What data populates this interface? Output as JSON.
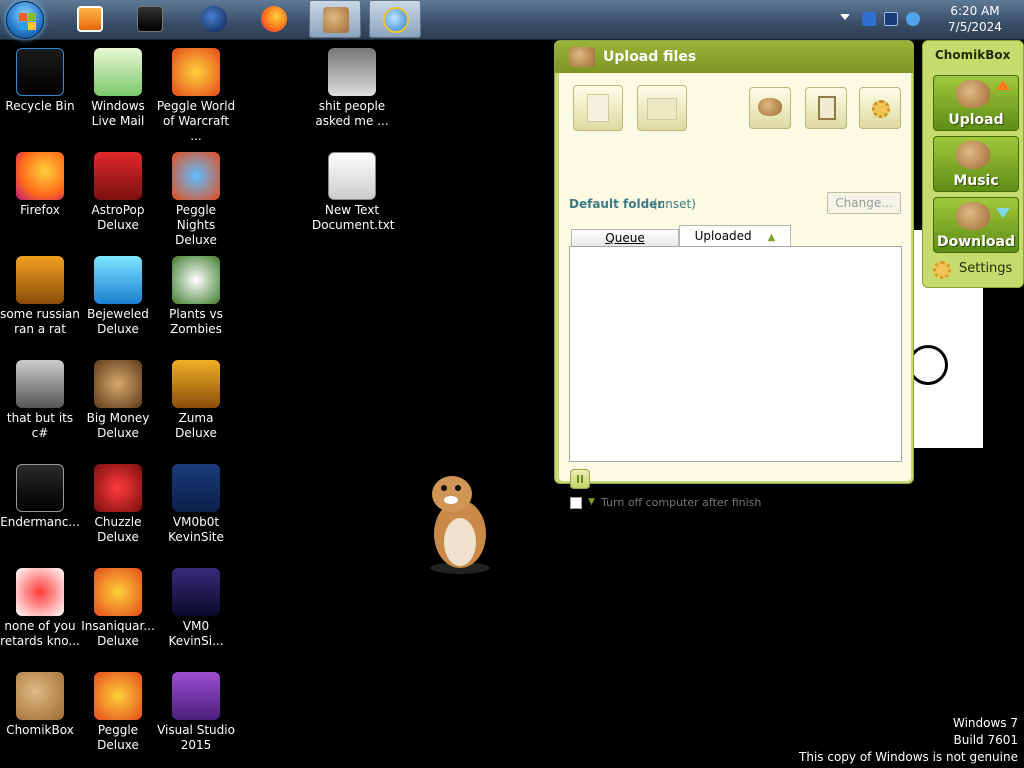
{
  "taskbar": {
    "apps": [
      {
        "name": "media-player-icon",
        "active": false
      },
      {
        "name": "app-icon",
        "active": false
      },
      {
        "name": "globe-icon",
        "active": false
      },
      {
        "name": "firefox-icon",
        "active": false
      },
      {
        "name": "chomikbox-icon",
        "active": true
      },
      {
        "name": "internet-explorer-icon",
        "active": true
      }
    ],
    "clock": {
      "time": "6:20 AM",
      "date": "7/5/2024"
    }
  },
  "desktop": {
    "icons": [
      {
        "label": "Recycle Bin"
      },
      {
        "label": "Windows Live Mail"
      },
      {
        "label": "Peggle World of Warcraft ..."
      },
      {
        "label": "shit people asked me ..."
      },
      {
        "label": "Firefox"
      },
      {
        "label": "AstroPop Deluxe"
      },
      {
        "label": "Peggle Nights Deluxe"
      },
      {
        "label": "New Text Document.txt"
      },
      {
        "label": "some russian ran a rat"
      },
      {
        "label": "Bejeweled Deluxe"
      },
      {
        "label": "Plants vs Zombies"
      },
      {
        "label": "that but its c#"
      },
      {
        "label": "Big Money Deluxe"
      },
      {
        "label": "Zuma Deluxe"
      },
      {
        "label": "Endermanc..."
      },
      {
        "label": "Chuzzle Deluxe"
      },
      {
        "label": "VM0b0t KevinSite"
      },
      {
        "label": "none of you retards kno..."
      },
      {
        "label": "Insaniquar... Deluxe"
      },
      {
        "label": "VM0 KevinSi..."
      },
      {
        "label": "ChomikBox"
      },
      {
        "label": "Peggle Deluxe"
      },
      {
        "label": "Visual Studio 2015"
      }
    ]
  },
  "upload_window": {
    "title": "Upload files",
    "default_folder_label": "Default folder",
    "default_folder_value": "(unset)",
    "change_button": "Change...",
    "tabs": [
      "Queue",
      "Uploaded"
    ],
    "shutdown_label": "Turn off computer after finish"
  },
  "chomik_panel": {
    "title": "ChomikBox",
    "buttons": [
      "Upload",
      "Music",
      "Download"
    ],
    "settings": "Settings"
  },
  "watermark": {
    "line1": "Windows 7",
    "line2": "Build 7601",
    "line3": "This copy of Windows is not genuine"
  }
}
